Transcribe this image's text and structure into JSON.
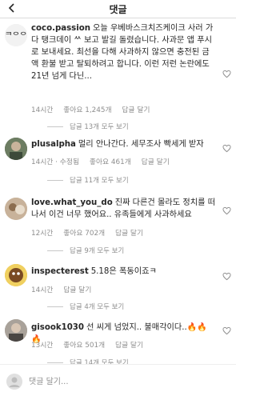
{
  "header": {
    "title": "댓글"
  },
  "comments": [
    {
      "username": "coco.passion",
      "text": "오늘 우베바스크치즈케이크 사러 가다 탱크데이 ᄊ 보고 발길 돌렸습니다. 사과문 앱 푸시로 보내세요. 최선을 다해 사과하지 않으면 충전된 금액 환불 받고 탈퇴하려고 합니다. 이런 저런 논란에도 21년 넘게 다닌...",
      "time": "14시간",
      "likes": "좋아요 1,245개",
      "reply": "답글 달기",
      "view_replies": "답글 13개 모두 보기"
    },
    {
      "username": "plusalpha",
      "text": "멀리 안나간다. 세무조사 빡세게 받자",
      "time": "14시간 · 수정됨",
      "likes": "좋아요 461개",
      "reply": "답글 달기",
      "view_replies": "답글 11개 모두 보기"
    },
    {
      "username": "love.what_you_do",
      "text": "진짜 다른건 몰라도 정치를 떠나서 이건 너무 했어요.. 유족들에게 사과하세요",
      "time": "12시간",
      "likes": "좋아요 702개",
      "reply": "답글 달기",
      "view_replies": "답글 9개 모두 보기"
    },
    {
      "username": "inspecterest",
      "text": "5.18은 폭동이죠ㅋ",
      "time": "14시간",
      "likes": "",
      "reply": "답글 달기",
      "view_replies": "답글 4개 모두 보기"
    },
    {
      "username": "gisook1030",
      "text": "선 씨게 넘었지.. 불매각이다..🔥🔥🔥",
      "time": "13시간",
      "likes": "좋아요 501개",
      "reply": "답글 달기",
      "view_replies": "답글 14개 모두 보기"
    }
  ],
  "input": {
    "placeholder": "댓글 달기..."
  },
  "icons": {
    "back": "chevron-left-icon",
    "like": "heart-outline-icon"
  },
  "colors": {
    "text": "#262626",
    "muted": "#8e8e8e",
    "divider": "#dbdbdb"
  }
}
